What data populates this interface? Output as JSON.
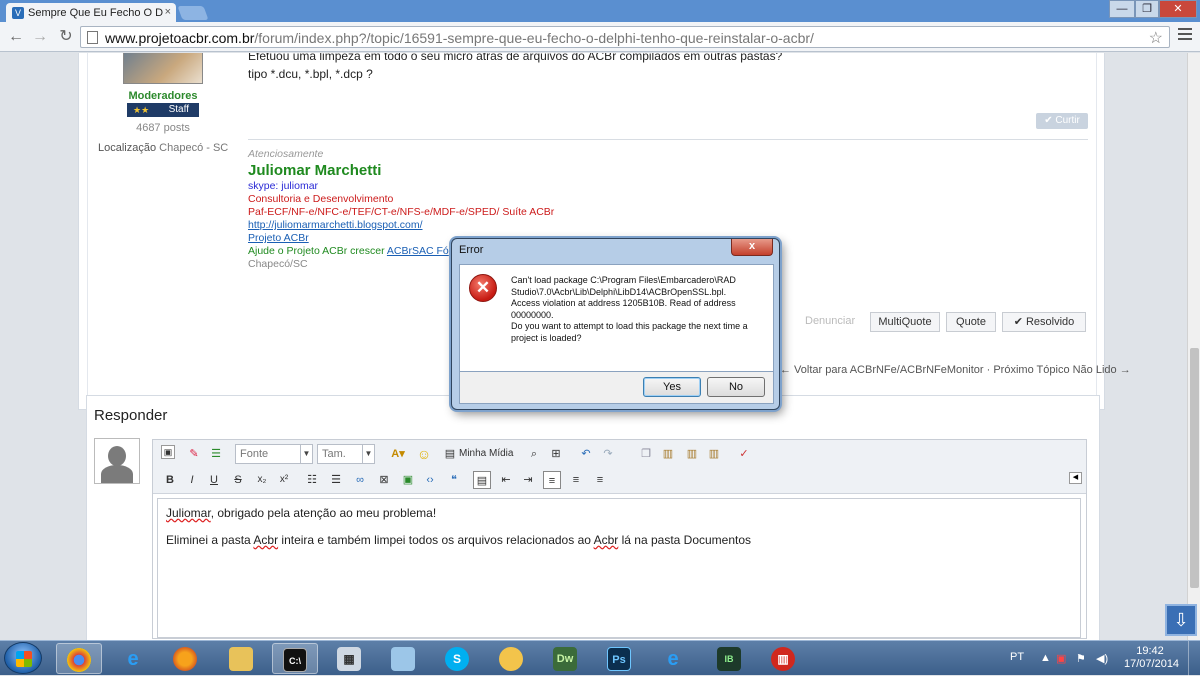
{
  "browser": {
    "tab_title": "Sempre Que Eu Fecho O D",
    "tab_close": "×",
    "url_host": "www.projetoacbr.com.br",
    "url_path": "/forum/index.php?/topic/16591-sempre-que-eu-fecho-o-delphi-tenho-que-reinstalar-o-acbr/"
  },
  "post": {
    "author_group": "Moderadores",
    "badge_stars": "★★",
    "badge_label": "Staff",
    "post_count": "4687 posts",
    "location_label": "Localização",
    "location_value": "Chapecó - SC",
    "body_line1": "Efetuou uma limpeza em todo o seu micro atrás de arquivos do ACBr compilados em outras pastas?",
    "body_line2": "tipo *.dcu, *.bpl, *.dcp ?",
    "like_label": "✔ Curtir",
    "signature": {
      "greeting": "Atenciosamente",
      "name": "Juliomar Marchetti",
      "skype": "skype: juliomar",
      "line1": "Consultoria e Desenvolvimento",
      "line2": "Paf-ECF/NF-e/NFC-e/TEF/CT-e/NFS-e/MDF-e/SPED/ Suíte ACBr",
      "blog_link": "http://juliomarmarchetti.blogspot.com/",
      "project_link": "Projeto ACBr",
      "help_text": "Ajude o Projeto ACBr crescer",
      "help_link": "ACBrSAC Fó",
      "city": "Chapecó/SC"
    },
    "actions": {
      "report": "Denunciar",
      "multiquote": "MultiQuote",
      "quote": "Quote",
      "resolved": "✔ Resolvido"
    }
  },
  "topic_nav": "← Voltar para ACBrNFe/ACBrNFeMonitor · Próximo Tópico Não Lido →",
  "reply": {
    "title": "Responder",
    "font_placeholder": "Fonte",
    "size_placeholder": "Tam.",
    "media_label": "Minha Mídia",
    "content": {
      "p1_name": "Juliomar",
      "p1_rest": ", obrigado pela atenção ao meu problema!",
      "p2_a": "Eliminei a pasta ",
      "p2_b": "Acbr",
      "p2_c": " inteira e também limpei todos os arquivos relacionados ao ",
      "p2_d": "Acbr",
      "p2_e": " lá na pasta Documentos"
    }
  },
  "dialog": {
    "title": "Error",
    "close": "x",
    "icon": "✕",
    "message_line1": "Can't load package C:\\Program Files\\Embarcadero\\RAD Studio\\7.0\\Acbr\\Lib\\Delphi\\LibD14\\ACBrOpenSSL.bpl.",
    "message_line2": "Access violation at address 1205B10B. Read of address 00000000.",
    "message_line3": "Do you want to attempt to load this package the next time a project is loaded?",
    "yes": "Yes",
    "no": "No"
  },
  "taskbar": {
    "language": "PT",
    "time": "19:42",
    "date": "17/07/2014"
  }
}
